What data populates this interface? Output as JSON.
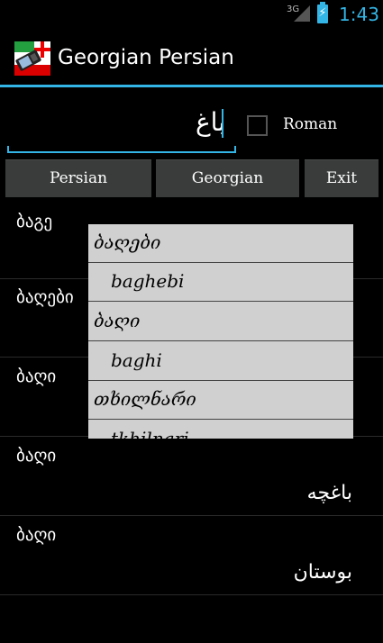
{
  "status_bar": {
    "network": "3G",
    "time": "1:43",
    "accent": "#33b5e5"
  },
  "action_bar": {
    "title": "Georgian Persian",
    "icon": "app-flag-icon"
  },
  "input": {
    "value": "باغ",
    "placeholder": ""
  },
  "options": {
    "roman_label": "Roman",
    "roman_checked": false
  },
  "buttons": {
    "persian": "Persian",
    "georgian": "Georgian",
    "exit": "Exit"
  },
  "results": [
    {
      "georgian": "ბაგე",
      "persian": ""
    },
    {
      "georgian": "ბაღები",
      "persian": ""
    },
    {
      "georgian": "ბაღი",
      "persian": ""
    },
    {
      "georgian": "ბაღი",
      "persian": "باغچه"
    },
    {
      "georgian": "ბაღი",
      "persian": "بوستان"
    }
  ],
  "popup": {
    "items": [
      {
        "text": "ბაღები",
        "indent": false
      },
      {
        "text": "baghebi",
        "indent": true
      },
      {
        "text": "ბაღი",
        "indent": false
      },
      {
        "text": "baghi",
        "indent": true
      },
      {
        "text": "თხილნარი",
        "indent": false
      },
      {
        "text": "tkhilnari",
        "indent": true
      }
    ]
  }
}
